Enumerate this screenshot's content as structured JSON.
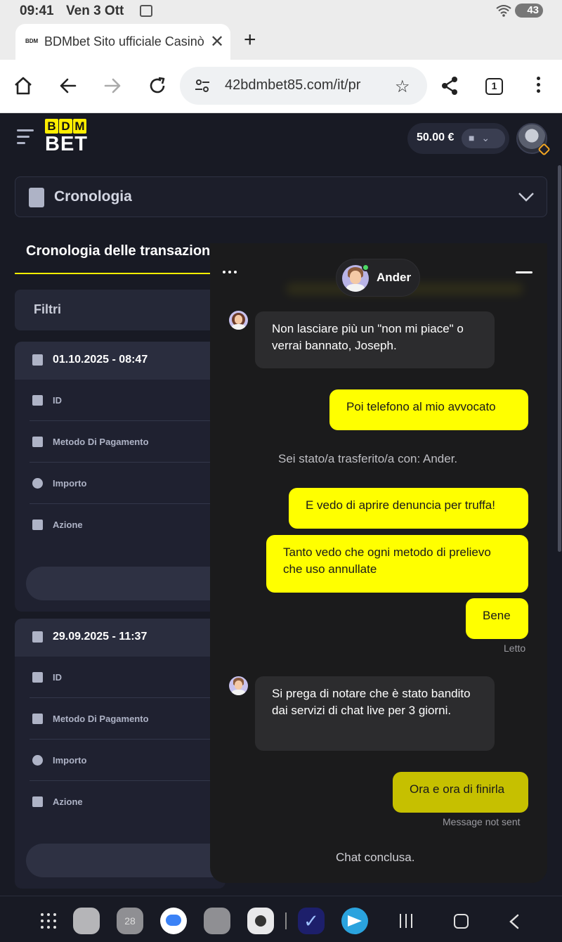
{
  "status_bar": {
    "time": "09:41",
    "date": "Ven 3 Ott",
    "battery": "43"
  },
  "browser": {
    "tab_favicon": "BDM",
    "tab_title": "BDMbet Sito ufficiale Casinò",
    "tab_close": "✕",
    "new_tab": "+",
    "url": "42bdmbet85.com/it/pr",
    "tab_count": "1"
  },
  "site": {
    "logo_top": [
      "B",
      "D",
      "M"
    ],
    "logo_bottom": "BET",
    "balance": "50.00 €",
    "section_dropdown": "Cronologia",
    "page_tab": "Cronologia delle transazioni",
    "filters_label": "Filtri",
    "accent_color": "#ffee00"
  },
  "transactions": [
    {
      "datetime": "01.10.2025 - 08:47",
      "fields": [
        "ID",
        "Metodo Di Pagamento",
        "Importo",
        "Azione"
      ]
    },
    {
      "datetime": "29.09.2025 - 11:37",
      "fields": [
        "ID",
        "Metodo Di Pagamento",
        "Importo",
        "Azione"
      ]
    }
  ],
  "chat": {
    "agent_name": "Ander",
    "messages": [
      {
        "from": "agent",
        "text": "Non lasciare più un \"non mi piace\" o verrai bannato, Joseph."
      },
      {
        "from": "user",
        "text": "Poi telefono al mio avvocato"
      },
      {
        "from": "system",
        "text": "Sei stato/a trasferito/a con: Ander."
      },
      {
        "from": "user",
        "text": "E vedo di aprire denuncia per truffa!"
      },
      {
        "from": "user",
        "text": "Tanto vedo che ogni metodo di prelievo che uso annullate"
      },
      {
        "from": "user",
        "text": "Bene"
      },
      {
        "from": "agent",
        "text": "Si prega di notare che è stato bandito dai servizi di chat live per 3 giorni."
      },
      {
        "from": "user",
        "text": "Ora e ora di finirla"
      }
    ],
    "read_receipt": "Letto",
    "not_sent": "Message not sent",
    "footer": "Chat conclusa.",
    "user_bubble_color": "#ffff00",
    "unsent_bubble_color": "#c6c000"
  },
  "nav_apps": [
    "apps-grid-icon",
    "folder-icon",
    "calendar-icon",
    "messages-icon",
    "gallery-icon",
    "camera-icon",
    "tasks-icon",
    "telegram-icon"
  ],
  "nav_calendar_day": "28"
}
